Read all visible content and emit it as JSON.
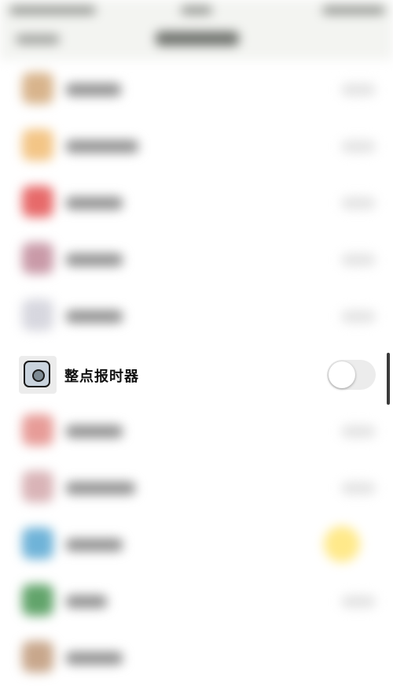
{
  "focused_item": {
    "label": "整点报时器",
    "toggle_on": false
  },
  "blurred_items": [
    {
      "icon_color": "#d8b48c"
    },
    {
      "icon_color": "#f3c586"
    },
    {
      "icon_color": "#e76a6a"
    },
    {
      "icon_color": "#c99aa8"
    },
    {
      "icon_color": "#d7d7df"
    },
    {
      "icon_color": "#e79c98"
    },
    {
      "icon_color": "#d9b4b7"
    },
    {
      "icon_color": "#6fb3d8"
    },
    {
      "icon_color": "#62a46b"
    },
    {
      "icon_color": "#c8a78c"
    }
  ],
  "colors": {
    "accent_blob": "#ffe98a",
    "toggle_track_off": "#ececec"
  }
}
